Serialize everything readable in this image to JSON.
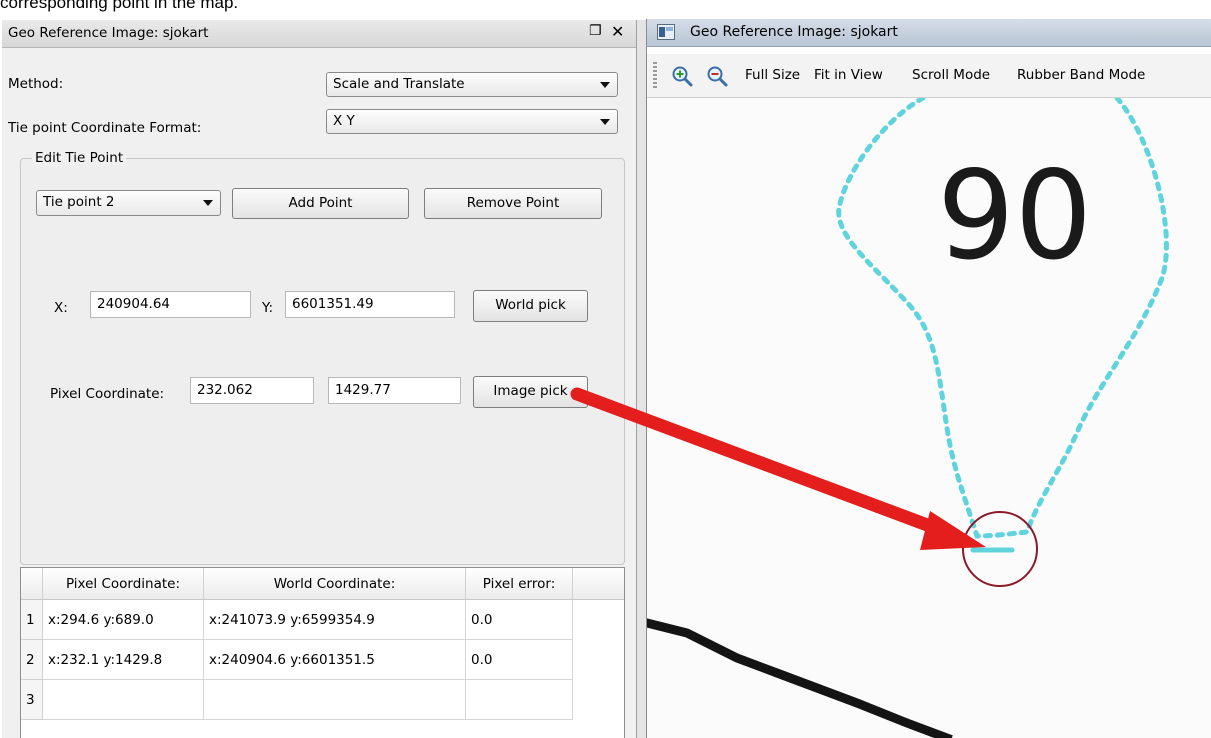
{
  "caption": "corresponding point in the map.",
  "left_panel": {
    "title": "Geo Reference Image: sjokart",
    "float_glyph": "❐",
    "close_glyph": "✕",
    "method_label": "Method:",
    "method_value": "Scale and Translate",
    "format_label": "Tie point Coordinate Format:",
    "format_value": "X Y",
    "group_title": "Edit Tie Point",
    "tie_point_value": "Tie point 2",
    "add_point_label": "Add Point",
    "remove_point_label": "Remove Point",
    "x_label": "X:",
    "x_value": "240904.64",
    "y_label": "Y:",
    "y_value": "6601351.49",
    "world_pick_label": "World pick",
    "pixel_coord_label": "Pixel Coordinate:",
    "pixel_x_value": "232.062",
    "pixel_y_value": "1429.77",
    "image_pick_label": "Image pick",
    "table": {
      "headers": [
        "Pixel Coordinate:",
        "World Coordinate:",
        "Pixel error:"
      ],
      "rows": [
        {
          "num": "1",
          "pixel": "x:294.6 y:689.0",
          "world": "x:241073.9  y:6599354.9",
          "error": "0.0"
        },
        {
          "num": "2",
          "pixel": "x:232.1 y:1429.8",
          "world": "x:240904.6  y:6601351.5",
          "error": "0.0"
        },
        {
          "num": "3",
          "pixel": "",
          "world": "",
          "error": ""
        }
      ]
    }
  },
  "right_window": {
    "title": "Geo Reference Image: sjokart",
    "toolbar": {
      "zoom_in_icon": "zoom-in-icon",
      "zoom_out_icon": "zoom-out-icon",
      "full_size": "Full Size",
      "fit_in_view": "Fit in View",
      "scroll_mode": "Scroll Mode",
      "rubber_band_mode": "Rubber Band Mode"
    },
    "map_label": "90",
    "colors": {
      "cyan_outline": "#5fd4dc",
      "pick_circle": "#8b1a2a",
      "arrow": "#e41d1d"
    }
  }
}
